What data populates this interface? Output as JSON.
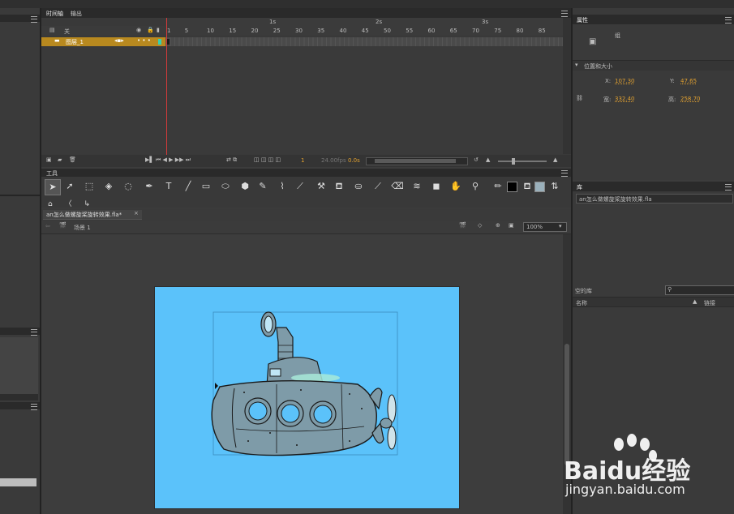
{
  "timeline": {
    "tabs": [
      "时间轴",
      "输出"
    ],
    "folder_label": "关",
    "layer_name": "图层_1",
    "frame_numbers": [
      "1",
      "5",
      "10",
      "15",
      "20",
      "25",
      "30",
      "35",
      "40",
      "45",
      "50",
      "55",
      "60",
      "65",
      "70",
      "75",
      "80",
      "85"
    ],
    "second_marks": [
      "1s",
      "2s",
      "3s"
    ],
    "current_frame": "1",
    "fps": "24.00fps",
    "time": "0.0s"
  },
  "tools_panel": {
    "title": "工具"
  },
  "document": {
    "tab_title": "an怎么做螺旋桨旋转效果.fla*",
    "scene_label": "场景 1",
    "zoom": "100%"
  },
  "properties": {
    "tab": "属性",
    "type_label": "组",
    "section": "位置和大小",
    "x_label": "X:",
    "x_value": "107.30",
    "y_label": "Y:",
    "y_value": "47.65",
    "w_label": "宽:",
    "w_value": "332.40",
    "h_label": "高:",
    "h_value": "258.70"
  },
  "library": {
    "tab": "库",
    "file_name": "an怎么做螺旋桨旋转效果.fla",
    "empty_label": "空的库",
    "col_name": "名称",
    "col_link": "链接"
  },
  "watermark": {
    "brand": "Baidu经验",
    "url": "jingyan.baidu.com"
  },
  "colors": {
    "stage": "#5bc2fa",
    "accent": "#e0a030",
    "playhead": "#d23a3a"
  }
}
